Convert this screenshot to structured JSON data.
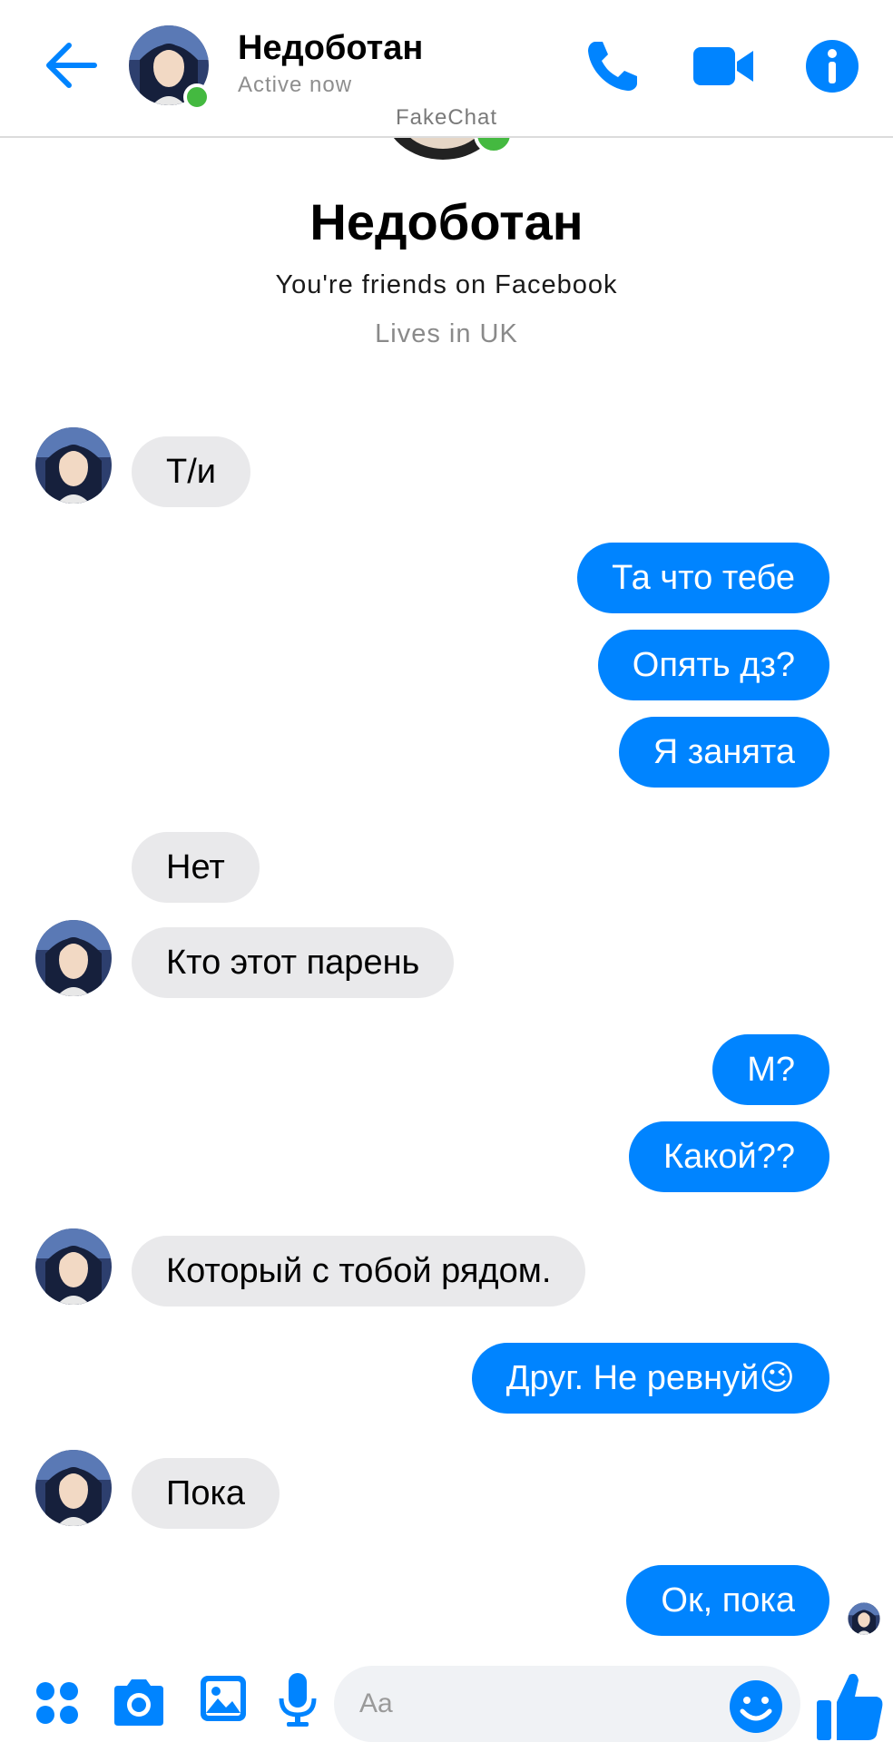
{
  "header": {
    "name": "Недоботан",
    "status": "Active now",
    "watermark": "FakeChat"
  },
  "profile": {
    "name": "Недоботан",
    "friends_text": "You're friends on Facebook",
    "lives_text": "Lives in UK"
  },
  "messages": [
    {
      "dir": "in",
      "text": "Т/и"
    },
    {
      "dir": "out",
      "text": "Та что тебе"
    },
    {
      "dir": "out",
      "text": "Опять дз?"
    },
    {
      "dir": "out",
      "text": "Я занята"
    },
    {
      "dir": "in",
      "text": "Нет"
    },
    {
      "dir": "in",
      "text": "Кто этот парень"
    },
    {
      "dir": "out",
      "text": "М?"
    },
    {
      "dir": "out",
      "text": "Какой??"
    },
    {
      "dir": "in",
      "text": "Который с тобой рядом."
    },
    {
      "dir": "out",
      "text": "Друг. Не ревнуй😉"
    },
    {
      "dir": "in",
      "text": "Пока"
    },
    {
      "dir": "out",
      "text": "Ок, пока"
    }
  ],
  "composer": {
    "placeholder": "Aa"
  },
  "colors": {
    "accent": "#0084ff",
    "incoming_bubble": "#e9e9eb",
    "online": "#44b940"
  },
  "icons": [
    "back-arrow-icon",
    "phone-icon",
    "video-camera-icon",
    "info-icon",
    "menu-dots-icon",
    "camera-icon",
    "image-icon",
    "microphone-icon",
    "emoji-icon",
    "thumbs-up-icon"
  ]
}
